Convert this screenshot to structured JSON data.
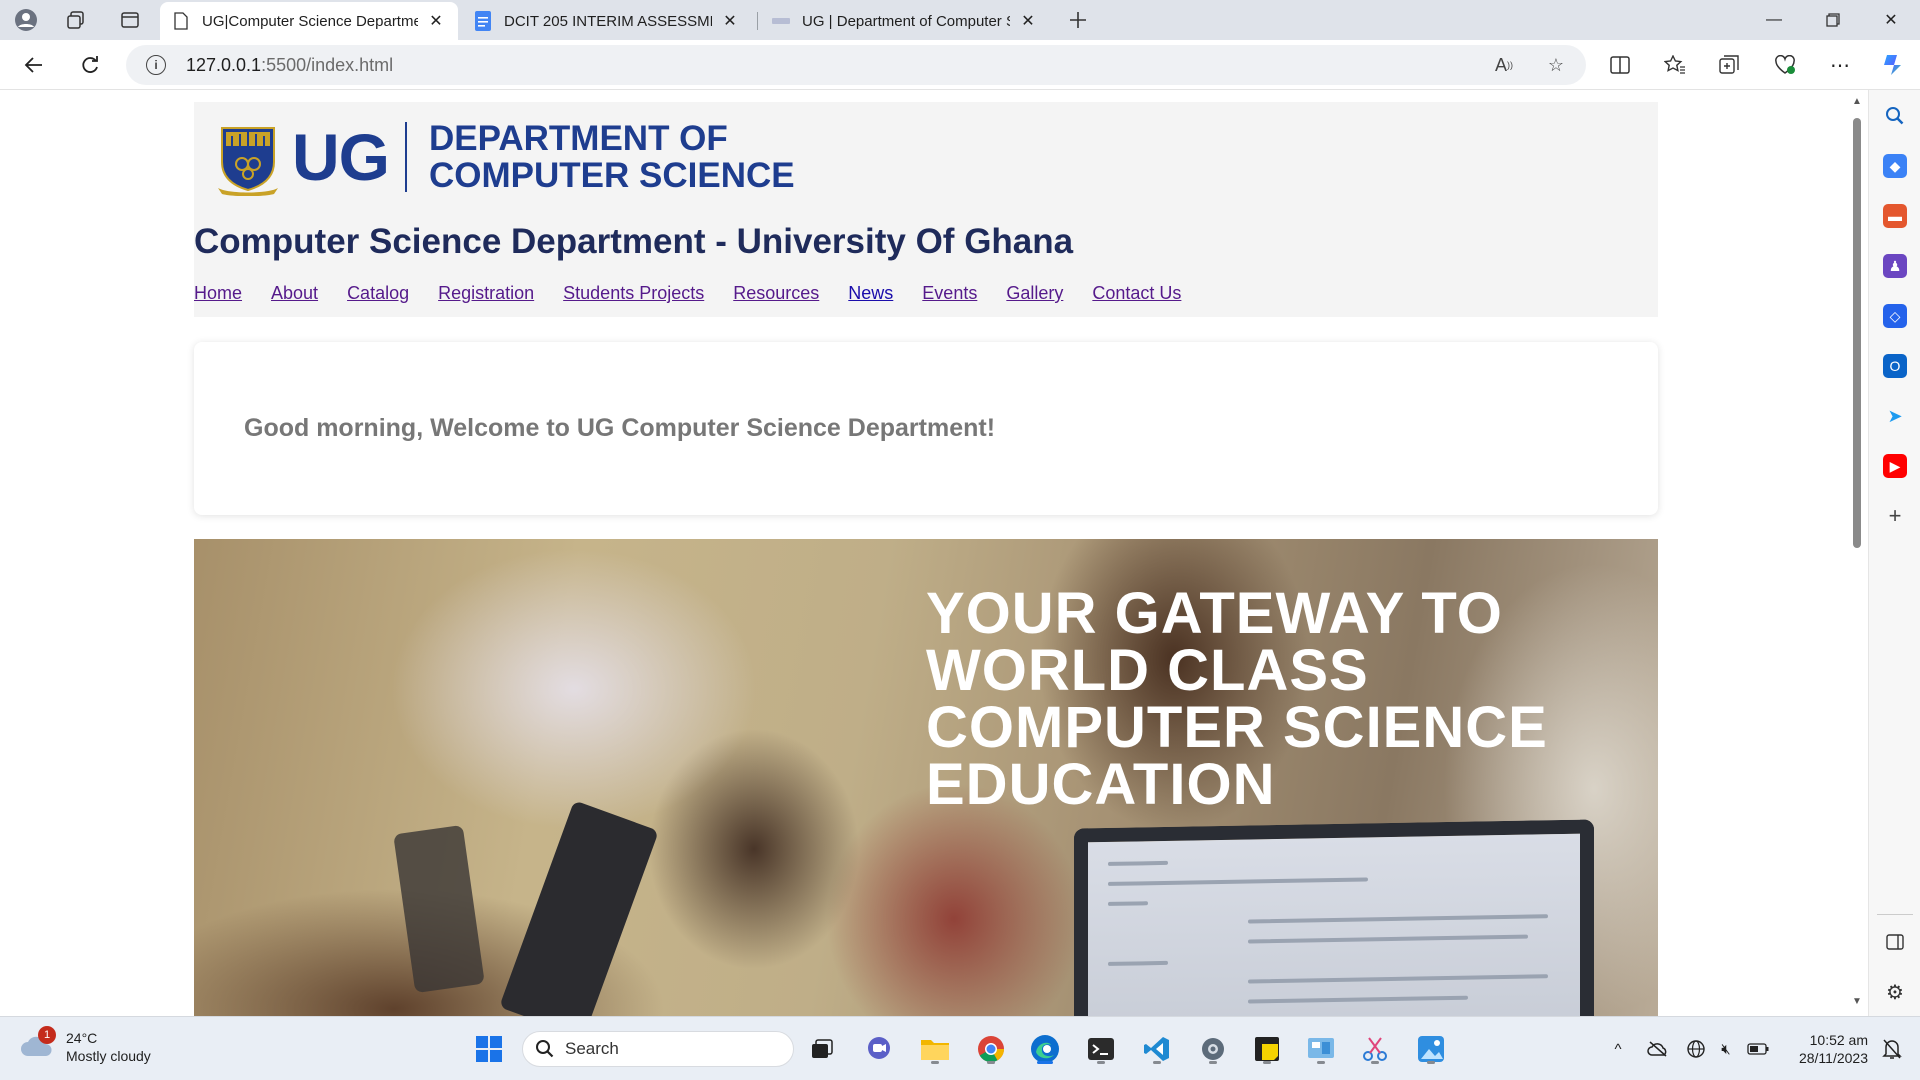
{
  "browser": {
    "tabs": [
      {
        "title": "UG|Computer Science Departme",
        "active": true
      },
      {
        "title": "DCIT 205 INTERIM ASSESSMENT",
        "active": false
      },
      {
        "title": "UG | Department of Computer Sc",
        "active": false
      }
    ],
    "url_host": "127.0.0.1",
    "url_path": ":5500/index.html"
  },
  "page": {
    "logo": {
      "ug": "UG",
      "dept_line1": "DEPARTMENT OF",
      "dept_line2": "COMPUTER SCIENCE"
    },
    "site_title": "Computer Science Department - University Of Ghana",
    "menu": [
      "Home",
      "About",
      "Catalog",
      "Registration",
      "Students Projects",
      "Resources",
      "News",
      "Events",
      "Gallery",
      "Contact Us"
    ],
    "welcome": "Good morning, Welcome to UG Computer Science Department!",
    "hero_lines": [
      "YOUR GATEWAY TO",
      "WORLD CLASS",
      "COMPUTER SCIENCE",
      "EDUCATION"
    ]
  },
  "taskbar": {
    "weather_temp": "24°C",
    "weather_desc": "Mostly cloudy",
    "weather_badge": "1",
    "search_label": "Search",
    "time": "10:52 am",
    "date": "28/11/2023"
  },
  "colors": {
    "brand_blue": "#1e3d8f",
    "title_navy": "#1f2b5b",
    "visited_link": "#551a8b",
    "link": "#1a0dab"
  }
}
